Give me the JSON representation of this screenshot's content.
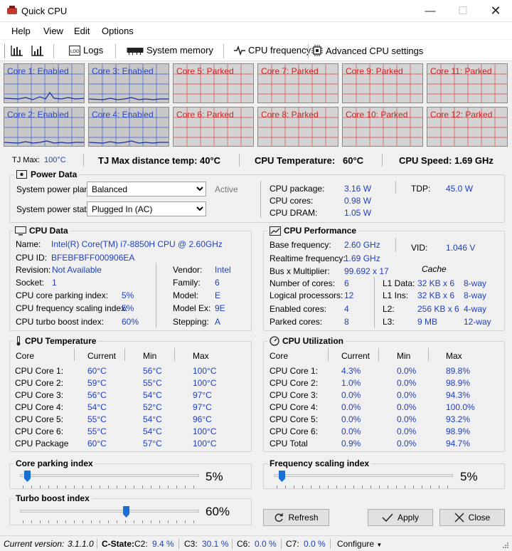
{
  "window": {
    "title": "Quick CPU"
  },
  "menu": [
    "Help",
    "View",
    "Edit",
    "Options"
  ],
  "toolbar": {
    "logs": "Logs",
    "system_memory": "System memory",
    "cpu_frequency": "CPU frequency",
    "advanced_cpu": "Advanced CPU settings"
  },
  "cores_row1": [
    "Core 1: Enabled",
    "Core 3: Enabled",
    "Core 5: Parked",
    "Core 7: Parked",
    "Core 9: Parked",
    "Core 11: Parked"
  ],
  "cores_row2": [
    "Core 2: Enabled",
    "Core 4: Enabled",
    "Core 6: Parked",
    "Core 8: Parked",
    "Core 10: Parked",
    "Core 12: Parked"
  ],
  "summary": {
    "tjmax_label": "TJ Max:",
    "tjmax_value": "100°C",
    "tjdist_label": "TJ Max distance temp:",
    "tjdist_value": "40°C",
    "cputemp_label": "CPU Temperature:",
    "cputemp_value": "60°C",
    "cpuspeed_label": "CPU Speed:",
    "cpuspeed_value": "1.69 GHz"
  },
  "power": {
    "title": "Power Data",
    "plan_label": "System power plan:",
    "plan_value": "Balanced",
    "plan_status": "Active",
    "state_label": "System power state:",
    "state_value": "Plugged In (AC)",
    "package_label": "CPU package:",
    "package_value": "3.16 W",
    "cores_label": "CPU cores:",
    "cores_value": "0.98 W",
    "dram_label": "CPU DRAM:",
    "dram_value": "1.05 W",
    "tdp_label": "TDP:",
    "tdp_value": "45.0 W"
  },
  "cpu_data": {
    "title": "CPU Data",
    "name_label": "Name:",
    "name_value": "Intel(R) Core(TM) i7-8850H CPU @ 2.60GHz",
    "id_label": "CPU ID:",
    "id_value": "BFEBFBFF000906EA",
    "revision_label": "Revision:",
    "revision_value": "Not Available",
    "socket_label": "Socket:",
    "socket_value": "1",
    "parking_label": "CPU core parking index:",
    "parking_value": "5%",
    "freqscale_label": "CPU frequency scaling index:",
    "freqscale_value": "5%",
    "turbo_label": "CPU turbo boost index:",
    "turbo_value": "60%",
    "vendor_label": "Vendor:",
    "vendor_value": "Intel",
    "family_label": "Family:",
    "family_value": "6",
    "model_label": "Model:",
    "model_value": "E",
    "modelex_label": "Model Ex:",
    "modelex_value": "9E",
    "stepping_label": "Stepping:",
    "stepping_value": "A"
  },
  "cpu_perf": {
    "title": "CPU Performance",
    "base_label": "Base frequency:",
    "base_value": "2.60 GHz",
    "vid_label": "VID:",
    "vid_value": "1.046 V",
    "realtime_label": "Realtime frequency:",
    "realtime_value": "1.69 GHz",
    "busmult_label": "Bus x Multiplier:",
    "busmult_value": "99.692 x 17",
    "cache_header": "Cache",
    "numcores_label": "Number of cores:",
    "numcores_value": "6",
    "logical_label": "Logical processors:",
    "logical_value": "12",
    "enabled_label": "Enabled cores:",
    "enabled_value": "4",
    "parked_label": "Parked cores:",
    "parked_value": "8",
    "cache_rows": [
      {
        "label": "L1 Data:",
        "size": "32 KB x 6",
        "way": "8-way"
      },
      {
        "label": "L1 Ins:",
        "size": "32 KB x 6",
        "way": "8-way"
      },
      {
        "label": "L2:",
        "size": "256 KB x 6",
        "way": "4-way"
      },
      {
        "label": "L3:",
        "size": "9 MB",
        "way": "12-way"
      }
    ]
  },
  "cpu_temp": {
    "title": "CPU Temperature",
    "headers": [
      "Core",
      "Current",
      "Min",
      "Max"
    ],
    "rows": [
      [
        "CPU Core 1:",
        "60°C",
        "56°C",
        "100°C"
      ],
      [
        "CPU Core 2:",
        "59°C",
        "55°C",
        "100°C"
      ],
      [
        "CPU Core 3:",
        "56°C",
        "54°C",
        "97°C"
      ],
      [
        "CPU Core 4:",
        "54°C",
        "52°C",
        "97°C"
      ],
      [
        "CPU Core 5:",
        "55°C",
        "54°C",
        "96°C"
      ],
      [
        "CPU Core 6:",
        "55°C",
        "54°C",
        "100°C"
      ],
      [
        "CPU Package",
        "60°C",
        "57°C",
        "100°C"
      ]
    ]
  },
  "cpu_util": {
    "title": "CPU Utilization",
    "headers": [
      "Core",
      "Current",
      "Min",
      "Max"
    ],
    "rows": [
      [
        "CPU Core 1:",
        "4.3%",
        "0.0%",
        "89.8%"
      ],
      [
        "CPU Core 2:",
        "1.0%",
        "0.0%",
        "98.9%"
      ],
      [
        "CPU Core 3:",
        "0.0%",
        "0.0%",
        "94.3%"
      ],
      [
        "CPU Core 4:",
        "0.0%",
        "0.0%",
        "100.0%"
      ],
      [
        "CPU Core 5:",
        "0.0%",
        "0.0%",
        "93.2%"
      ],
      [
        "CPU Core 6:",
        "0.0%",
        "0.0%",
        "98.9%"
      ],
      [
        "CPU Total",
        "0.9%",
        "0.0%",
        "94.7%"
      ]
    ]
  },
  "sliders": {
    "parking": {
      "title": "Core parking index",
      "value": "5%"
    },
    "freq": {
      "title": "Frequency scaling index",
      "value": "5%"
    },
    "turbo": {
      "title": "Turbo boost index",
      "value": "60%"
    }
  },
  "buttons": {
    "refresh": "Refresh",
    "apply": "Apply",
    "close": "Close"
  },
  "status": {
    "version_label": "Current version:",
    "version_value": "3.1.1.0",
    "cstate_label": "C-State:",
    "c2_label": "C2:",
    "c2_value": "9.4 %",
    "c3_label": "C3:",
    "c3_value": "30.1 %",
    "c6_label": "C6:",
    "c6_value": "0.0 %",
    "c7_label": "C7:",
    "c7_value": "0.0 %",
    "configure": "Configure"
  }
}
